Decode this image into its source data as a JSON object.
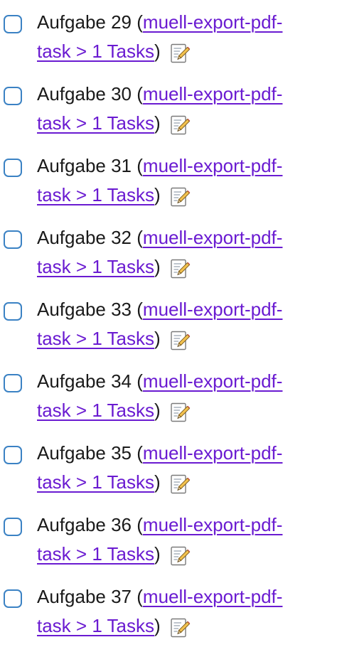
{
  "tasks": [
    {
      "label": "Aufgabe 29",
      "link_part1": "muell-export-pdf-",
      "link_part2": "task > 1 Tasks"
    },
    {
      "label": "Aufgabe 30",
      "link_part1": "muell-export-pdf-",
      "link_part2": "task > 1 Tasks"
    },
    {
      "label": "Aufgabe 31",
      "link_part1": "muell-export-pdf-",
      "link_part2": "task > 1 Tasks"
    },
    {
      "label": "Aufgabe 32",
      "link_part1": "muell-export-pdf-",
      "link_part2": "task > 1 Tasks"
    },
    {
      "label": "Aufgabe 33",
      "link_part1": "muell-export-pdf-",
      "link_part2": "task > 1 Tasks"
    },
    {
      "label": "Aufgabe 34",
      "link_part1": "muell-export-pdf-",
      "link_part2": "task > 1 Tasks"
    },
    {
      "label": "Aufgabe 35",
      "link_part1": "muell-export-pdf-",
      "link_part2": "task > 1 Tasks"
    },
    {
      "label": "Aufgabe 36",
      "link_part1": "muell-export-pdf-",
      "link_part2": "task > 1 Tasks"
    },
    {
      "label": "Aufgabe 37",
      "link_part1": "muell-export-pdf-",
      "link_part2": "task > 1 Tasks"
    }
  ],
  "punctuation": {
    "open_paren": " (",
    "close_paren": ")"
  },
  "icons": {
    "checkbox": "checkbox-icon",
    "edit": "edit-note-icon"
  },
  "colors": {
    "link": "#6a1bd1",
    "checkbox_border": "#3b82c4",
    "text": "#1a1a1a"
  }
}
